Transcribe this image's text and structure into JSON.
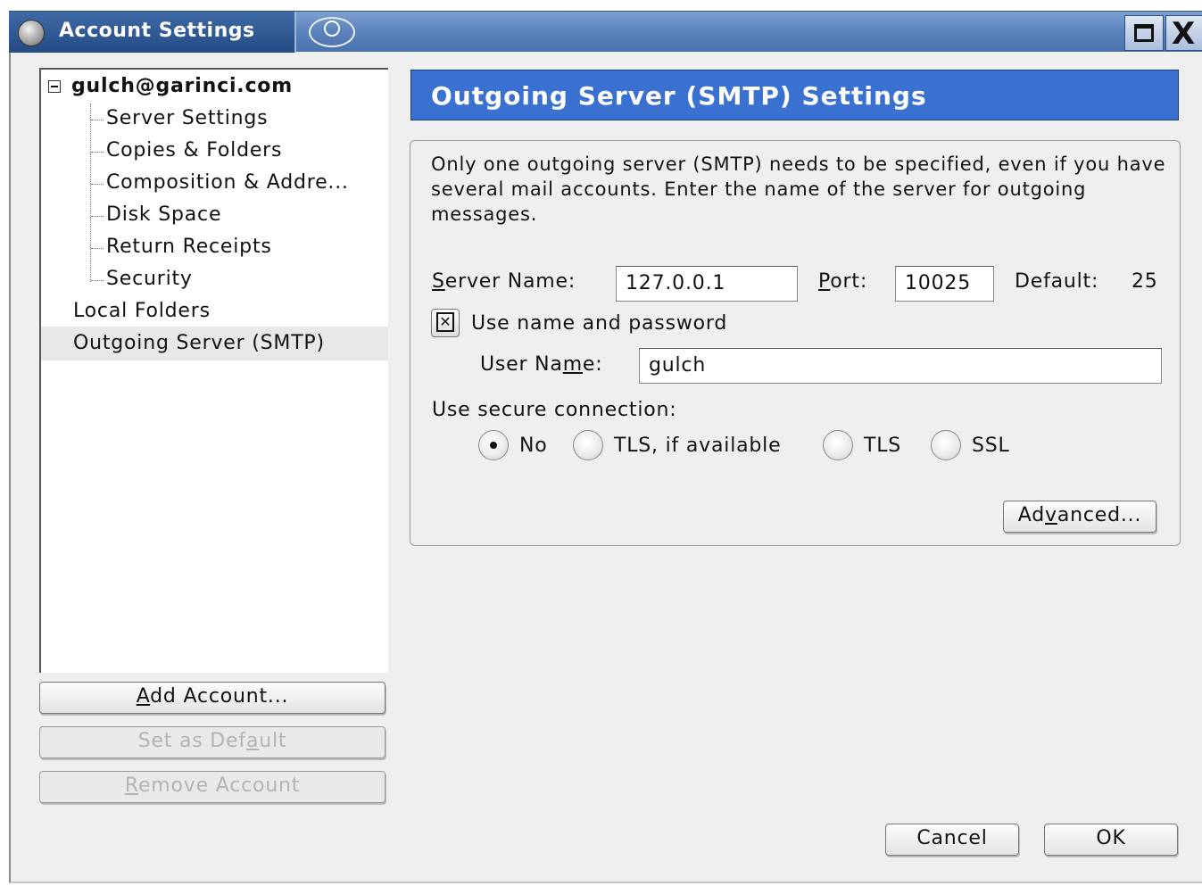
{
  "window": {
    "title": "Account Settings"
  },
  "tree": {
    "account": "gulch@garinci.com",
    "children": [
      "Server Settings",
      "Copies & Folders",
      "Composition & Addre...",
      "Disk Space",
      "Return Receipts",
      "Security"
    ],
    "local_folders": "Local Folders",
    "outgoing": "Outgoing Server (SMTP)"
  },
  "left_buttons": {
    "add_account": {
      "mnemonic": "A",
      "rest": "dd Account..."
    },
    "set_default": {
      "pre": "Set as Def",
      "mnemonic": "a",
      "post": "ult"
    },
    "remove_account": {
      "mnemonic": "R",
      "rest": "emove Account"
    }
  },
  "panel": {
    "header": "Outgoing Server (SMTP) Settings",
    "description": "Only one outgoing server (SMTP) needs to be specified, even if you have several mail accounts. Enter the name of the server for outgoing messages.",
    "server_name_label": {
      "mnemonic": "S",
      "rest": "erver Name:"
    },
    "server_name_value": "127.0.0.1",
    "port_label": {
      "mnemonic": "P",
      "rest": "ort:"
    },
    "port_value": "10025",
    "default_label": "Default:",
    "default_value": "25",
    "use_name_password_label": "Use name and password",
    "use_name_password_checked": true,
    "user_name_label": {
      "pre": "User Na",
      "mnemonic": "m",
      "post": "e:"
    },
    "user_name_value": "gulch",
    "secure_connection_label": "Use secure connection:",
    "secure_options": [
      "No",
      "TLS, if available",
      "TLS",
      "SSL"
    ],
    "secure_selected": "No",
    "advanced_button": {
      "pre": "Ad",
      "mnemonic": "v",
      "post": "anced..."
    }
  },
  "footer": {
    "cancel": "Cancel",
    "ok": "OK"
  }
}
